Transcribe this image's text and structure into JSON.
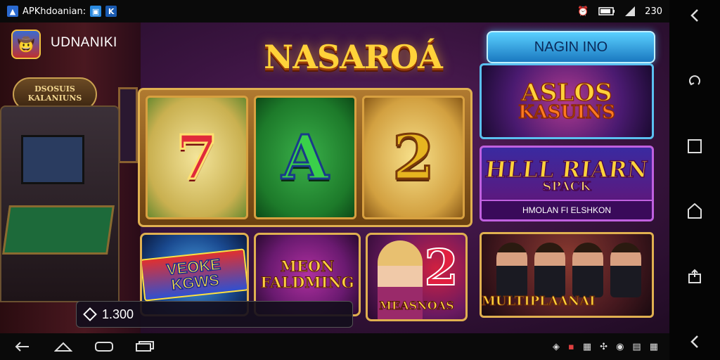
{
  "status_bar": {
    "app_label": "APKhdoanian:",
    "time": "230"
  },
  "app": {
    "name": "UDNANIKI",
    "title": "NASAROÁ"
  },
  "background": {
    "sign_line1": "DSOSUIS",
    "sign_line2": "KALANIUNS"
  },
  "reels": [
    {
      "symbol": "7"
    },
    {
      "symbol": "A"
    },
    {
      "symbol": "2"
    }
  ],
  "promo_banner": {
    "label": "NAGIN INO"
  },
  "games": {
    "aslos": {
      "line1": "ASLOS",
      "line2": "KASUINS"
    },
    "hall": {
      "line1": "HLLL RIARN",
      "line2": "SPACK",
      "caption": "HMOLAN FI ELSHKON"
    },
    "video": {
      "label": "VEOKE KGWS"
    },
    "meon": {
      "line1": "MEON",
      "line2": "FALDMING"
    },
    "messnoas": {
      "label": "MEASNOAS"
    },
    "multi": {
      "label": "MULTIPLAANAI"
    }
  },
  "balance": {
    "value": "1.300"
  },
  "colors": {
    "accent_gold": "#ffd23a",
    "banner_blue": "#3aa0e0",
    "background_purple": "#3a1440"
  }
}
